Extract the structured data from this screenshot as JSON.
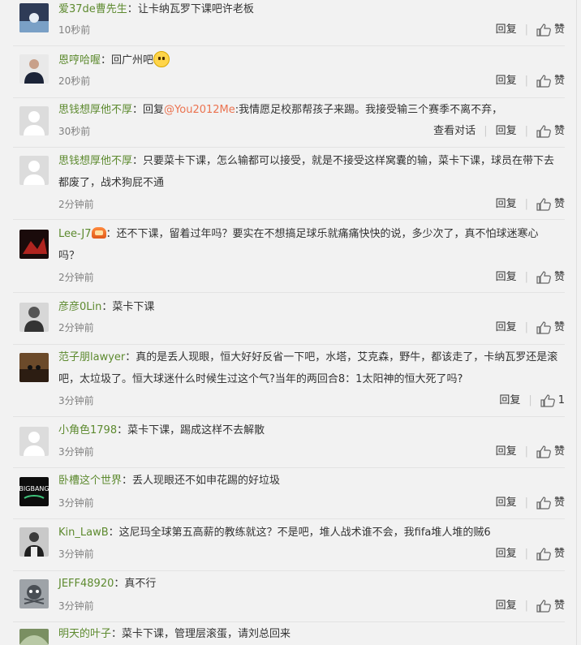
{
  "comments": [
    {
      "name": "爱37de曹先生",
      "text": "让卡纳瓦罗下课吧许老板",
      "time": "10秒前",
      "reply": "回复",
      "like": "赞"
    },
    {
      "name": "恩哼哈喔",
      "text": "回广州吧",
      "time": "20秒前",
      "reply": "回复",
      "like": "赞"
    },
    {
      "name": "思钱想厚他不厚",
      "reply_prefix": "回复",
      "mention": "@You2012Me",
      "text": "我情愿足校那帮孩子来踢。我接受输三个赛季不离不弃，",
      "time": "30秒前",
      "view": "查看对话",
      "reply": "回复",
      "like": "赞"
    },
    {
      "name": "思钱想厚他不厚",
      "text": "只要菜卡下课，怎么输都可以接受，就是不接受这样窝囊的输，菜卡下课，球员在带下去都废了，战术狗屁不通",
      "time": "2分钟前",
      "reply": "回复",
      "like": "赞"
    },
    {
      "name": "Lee-J7",
      "text": "还不下课，留着过年吗？要实在不想搞足球乐就痛痛快快的说，多少次了，真不怕球迷寒心吗？",
      "time": "2分钟前",
      "reply": "回复",
      "like": "赞"
    },
    {
      "name": "彦彦0Lin",
      "text": "菜卡下课",
      "time": "2分钟前",
      "reply": "回复",
      "like": "赞"
    },
    {
      "name": "范子朋lawyer",
      "text": "真的是丢人现眼，恒大好好反省一下吧，水塔，艾克森，野牛，都该走了，卡纳瓦罗还是滚吧，太垃圾了。恒大球迷什么时候生过这个气?当年的两回合8：1太阳神的恒大死了吗?",
      "time": "3分钟前",
      "reply": "回复",
      "like": "1"
    },
    {
      "name": "小角色1798",
      "text": "菜卡下课，踢成这样不去解散",
      "time": "3分钟前",
      "reply": "回复",
      "like": "赞"
    },
    {
      "name": "卧槽这个世界",
      "text": "丢人现眼还不如申花踢的好垃圾",
      "time": "3分钟前",
      "reply": "回复",
      "like": "赞"
    },
    {
      "name": "Kin_LawB",
      "text": "这尼玛全球第五高薪的教练就这？不是吧，堆人战术谁不会，我fifa堆人堆的贼6",
      "time": "3分钟前",
      "reply": "回复",
      "like": "赞"
    },
    {
      "name": "JEFF48920",
      "text": "真不行",
      "time": "3分钟前",
      "reply": "回复",
      "like": "赞"
    },
    {
      "name": "明天的叶子",
      "text": "菜卡下课，管理层滚蛋，请刘总回来"
    }
  ],
  "colors": {
    "username": "#5d8a2f",
    "mention": "#eb7350",
    "text": "#333333",
    "time": "#808080",
    "background": "#f2f2f2"
  },
  "avatar_badge_image": "BIGBANG"
}
